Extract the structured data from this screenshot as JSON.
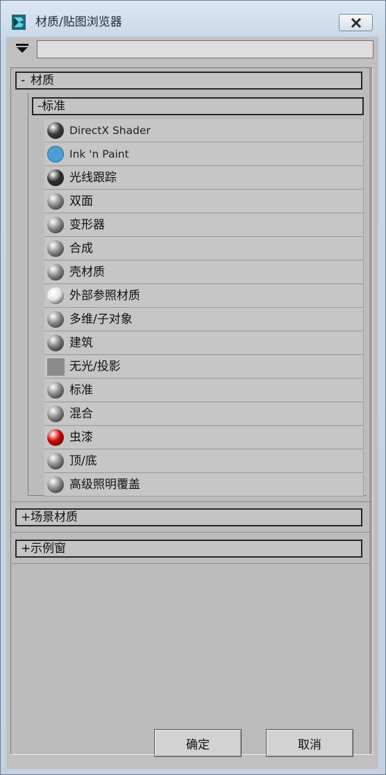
{
  "window": {
    "title": "材质/贴图浏览器"
  },
  "filter": {
    "value": "",
    "placeholder": ""
  },
  "sections": {
    "materials": {
      "sign": "-",
      "label": "材质"
    },
    "standard": {
      "sign": "-",
      "label": "标准"
    },
    "scene_materials": {
      "sign": "+",
      "label": "场景材质"
    },
    "sample_slots": {
      "sign": "+",
      "label": "示例窗"
    }
  },
  "items": [
    {
      "label": "DirectX Shader",
      "swatch": "#3a3a3a",
      "kind": "sphere"
    },
    {
      "label": "Ink 'n Paint",
      "swatch": "#4a9fd6",
      "kind": "flat-sphere"
    },
    {
      "label": "光线跟踪",
      "swatch": "#2f2f2f",
      "kind": "sphere"
    },
    {
      "label": "双面",
      "swatch": "#8a8a8a",
      "kind": "sphere"
    },
    {
      "label": "变形器",
      "swatch": "#8a8a8a",
      "kind": "sphere"
    },
    {
      "label": "合成",
      "swatch": "#8a8a8a",
      "kind": "sphere"
    },
    {
      "label": "壳材质",
      "swatch": "#8a8a8a",
      "kind": "sphere"
    },
    {
      "label": "外部参照材质",
      "swatch": "#e6e6e6",
      "kind": "sphere"
    },
    {
      "label": "多维/子对象",
      "swatch": "#8a8a8a",
      "kind": "sphere"
    },
    {
      "label": "建筑",
      "swatch": "#7a7a7a",
      "kind": "sphere"
    },
    {
      "label": "无光/投影",
      "swatch": "#8a8a8a",
      "kind": "flat"
    },
    {
      "label": "标准",
      "swatch": "#8a8a8a",
      "kind": "sphere"
    },
    {
      "label": "混合",
      "swatch": "#8a8a8a",
      "kind": "sphere"
    },
    {
      "label": "虫漆",
      "swatch": "#d40000",
      "kind": "sphere"
    },
    {
      "label": "顶/底",
      "swatch": "#8a8a8a",
      "kind": "sphere"
    },
    {
      "label": "高级照明覆盖",
      "swatch": "#8a8a8a",
      "kind": "sphere"
    }
  ],
  "buttons": {
    "ok": "确定",
    "cancel": "取消"
  }
}
